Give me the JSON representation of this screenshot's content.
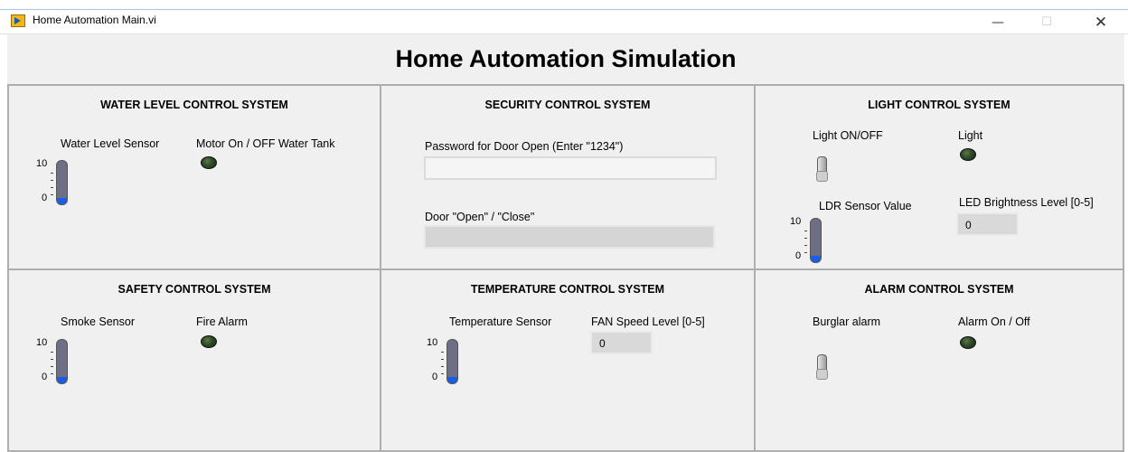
{
  "window": {
    "title": "Home Automation Main.vi",
    "controls": {
      "minimize": "—",
      "maximize": "☐",
      "close": "✕"
    }
  },
  "page_title": "Home Automation Simulation",
  "water": {
    "title": "WATER LEVEL CONTROL SYSTEM",
    "sensor_label": "Water Level Sensor",
    "scale_max": "10",
    "scale_min": "0",
    "sensor_level": 0,
    "motor_label": "Motor On / OFF Water Tank",
    "motor_state": "off"
  },
  "security": {
    "title": "SECURITY CONTROL SYSTEM",
    "password_label": "Password for Door Open (Enter \"1234\")",
    "password_value": "",
    "door_label": "Door \"Open\" / \"Close\"",
    "door_value": ""
  },
  "light": {
    "title": "LIGHT CONTROL SYSTEM",
    "switch_label": "Light ON/OFF",
    "switch_state": "off",
    "led_label": "Light",
    "led_state": "off",
    "ldr_label": "LDR Sensor Value",
    "ldr_scale_max": "10",
    "ldr_scale_min": "0",
    "ldr_level": 0,
    "brightness_label": "LED Brightness Level [0-5]",
    "brightness_value": "0"
  },
  "safety": {
    "title": "SAFETY CONTROL SYSTEM",
    "smoke_label": "Smoke Sensor",
    "scale_max": "10",
    "scale_min": "0",
    "smoke_level": 0,
    "alarm_label": "Fire Alarm",
    "alarm_state": "off"
  },
  "temperature": {
    "title": "TEMPERATURE CONTROL SYSTEM",
    "sensor_label": "Temperature Sensor",
    "scale_max": "10",
    "scale_min": "0",
    "sensor_level": 0,
    "fan_label": "FAN Speed Level [0-5]",
    "fan_value": "0"
  },
  "alarm": {
    "title": "ALARM CONTROL SYSTEM",
    "burglar_label": "Burglar alarm",
    "burglar_state": "off",
    "onoff_label": "Alarm On / Off",
    "led_state": "off"
  },
  "colors": {
    "panel_bg": "#f0f0f0",
    "tank_body": "#6e6f86",
    "tank_fill": "#1a5ee8",
    "led_off": "#2f4a26"
  }
}
